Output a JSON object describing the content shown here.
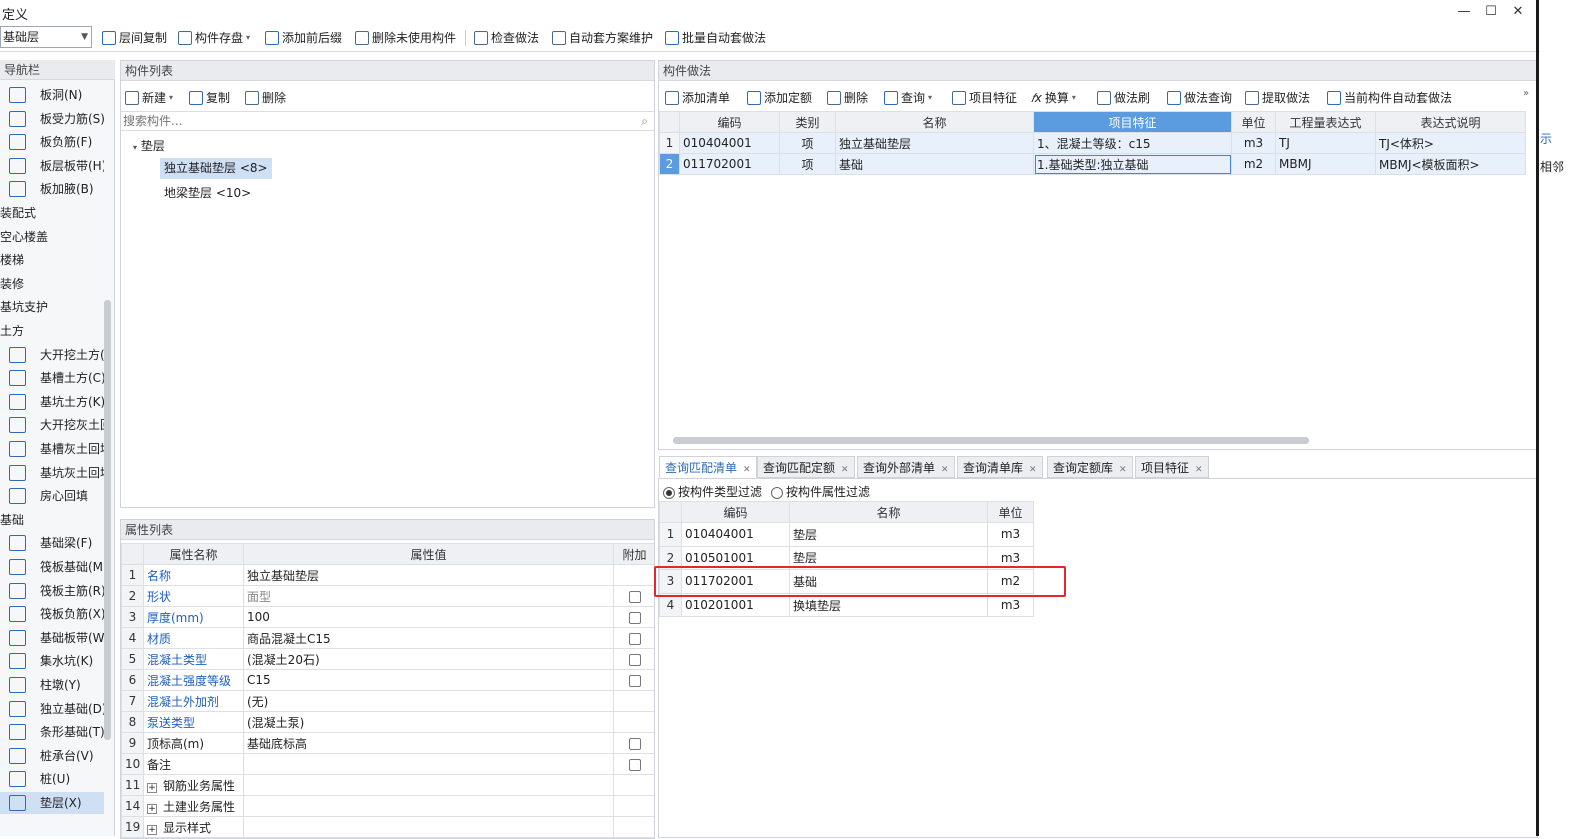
{
  "window": {
    "title": "定义",
    "min": "—",
    "max": "☐",
    "close": "✕"
  },
  "toolbar": {
    "floor": "基础层",
    "items": [
      "层间复制",
      "构件存盘",
      "添加前后缀",
      "删除未使用构件",
      "检查做法",
      "自动套方案维护",
      "批量自动套做法"
    ]
  },
  "nav": {
    "title": "导航栏",
    "items": [
      {
        "label": "板洞(N)",
        "cat": false
      },
      {
        "label": "板受力筋(S)",
        "cat": false
      },
      {
        "label": "板负筋(F)",
        "cat": false
      },
      {
        "label": "板层板带(H)",
        "cat": false
      },
      {
        "label": "板加腋(B)",
        "cat": false
      },
      {
        "label": "装配式",
        "cat": true
      },
      {
        "label": "空心楼盖",
        "cat": true
      },
      {
        "label": "楼梯",
        "cat": true
      },
      {
        "label": "装修",
        "cat": true
      },
      {
        "label": "基坑支护",
        "cat": true
      },
      {
        "label": "土方",
        "cat": true
      },
      {
        "label": "大开挖土方(W)",
        "cat": false
      },
      {
        "label": "基槽土方(C)",
        "cat": false
      },
      {
        "label": "基坑土方(K)",
        "cat": false
      },
      {
        "label": "大开挖灰土回填",
        "cat": false
      },
      {
        "label": "基槽灰土回填",
        "cat": false
      },
      {
        "label": "基坑灰土回填",
        "cat": false
      },
      {
        "label": "房心回填",
        "cat": false
      },
      {
        "label": "基础",
        "cat": true
      },
      {
        "label": "基础梁(F)",
        "cat": false
      },
      {
        "label": "筏板基础(M)",
        "cat": false
      },
      {
        "label": "筏板主筋(R)",
        "cat": false
      },
      {
        "label": "筏板负筋(X)",
        "cat": false
      },
      {
        "label": "基础板带(W)",
        "cat": false
      },
      {
        "label": "集水坑(K)",
        "cat": false
      },
      {
        "label": "柱墩(Y)",
        "cat": false
      },
      {
        "label": "独立基础(D)",
        "cat": false
      },
      {
        "label": "条形基础(T)",
        "cat": false
      },
      {
        "label": "桩承台(V)",
        "cat": false
      },
      {
        "label": "桩(U)",
        "cat": false
      },
      {
        "label": "垫层(X)",
        "cat": false,
        "sel": true
      }
    ]
  },
  "complist": {
    "title": "构件列表",
    "btn_new": "新建",
    "btn_copy": "复制",
    "btn_delete": "删除",
    "search_placeholder": "搜索构件...",
    "root": "垫层",
    "items": [
      "独立基础垫层 <8>",
      "地梁垫层 <10>"
    ]
  },
  "props": {
    "title": "属性列表",
    "headers": [
      "属性名称",
      "属性值",
      "附加"
    ],
    "rows": [
      {
        "n": "1",
        "name": "名称",
        "value": "独立基础垫层",
        "blue": true,
        "cb": false
      },
      {
        "n": "2",
        "name": "形状",
        "value": "面型",
        "blue": true,
        "cb": true,
        "grey": true
      },
      {
        "n": "3",
        "name": "厚度(mm)",
        "value": "100",
        "blue": true,
        "cb": true
      },
      {
        "n": "4",
        "name": "材质",
        "value": "商品混凝土C15",
        "blue": true,
        "cb": true
      },
      {
        "n": "5",
        "name": "混凝土类型",
        "value": "(混凝土20石)",
        "blue": true,
        "cb": true
      },
      {
        "n": "6",
        "name": "混凝土强度等级",
        "value": "C15",
        "blue": true,
        "cb": true
      },
      {
        "n": "7",
        "name": "混凝土外加剂",
        "value": "(无)",
        "blue": true,
        "cb": false
      },
      {
        "n": "8",
        "name": "泵送类型",
        "value": "(混凝土泵)",
        "blue": true,
        "cb": false
      },
      {
        "n": "9",
        "name": "顶标高(m)",
        "value": "基础底标高",
        "blue": false,
        "cb": true
      },
      {
        "n": "10",
        "name": "备注",
        "value": "",
        "blue": false,
        "cb": true
      },
      {
        "n": "11",
        "name": "钢筋业务属性",
        "value": "",
        "blue": false,
        "cb": false,
        "exp": true
      },
      {
        "n": "14",
        "name": "土建业务属性",
        "value": "",
        "blue": false,
        "cb": false,
        "exp": true
      },
      {
        "n": "19",
        "name": "显示样式",
        "value": "",
        "blue": false,
        "cb": false,
        "exp": true
      }
    ]
  },
  "method": {
    "title": "构件做法",
    "tools": [
      "添加清单",
      "添加定额",
      "删除",
      "查询",
      "项目特征",
      "换算",
      "做法刷",
      "做法查询",
      "提取做法",
      "当前构件自动套做法"
    ],
    "headers": [
      "编码",
      "类别",
      "名称",
      "项目特征",
      "单位",
      "工程量表达式",
      "表达式说明"
    ],
    "rows": [
      {
        "n": "1",
        "code": "010404001",
        "type": "项",
        "name": "独立基础垫层",
        "feature": "1、混凝土等级：c15",
        "unit": "m3",
        "expr": "TJ",
        "desc": "TJ<体积>"
      },
      {
        "n": "2",
        "code": "011702001",
        "type": "项",
        "name": "基础",
        "feature": "1.基础类型:独立基础",
        "unit": "m2",
        "expr": "MBMJ",
        "desc": "MBMJ<模板面积>"
      }
    ]
  },
  "query": {
    "tabs": [
      "查询匹配清单",
      "查询匹配定额",
      "查询外部清单",
      "查询清单库",
      "查询定额库",
      "项目特征"
    ],
    "filter1": "按构件类型过滤",
    "filter2": "按构件属性过滤",
    "headers": [
      "编码",
      "名称",
      "单位"
    ],
    "rows": [
      {
        "n": "1",
        "code": "010404001",
        "name": "垫层",
        "unit": "m3"
      },
      {
        "n": "2",
        "code": "010501001",
        "name": "垫层",
        "unit": "m3"
      },
      {
        "n": "3",
        "code": "011702001",
        "name": "基础",
        "unit": "m2"
      },
      {
        "n": "4",
        "code": "010201001",
        "name": "换填垫层",
        "unit": "m3"
      }
    ]
  },
  "edge": {
    "a": "示",
    "b": "相邻"
  }
}
